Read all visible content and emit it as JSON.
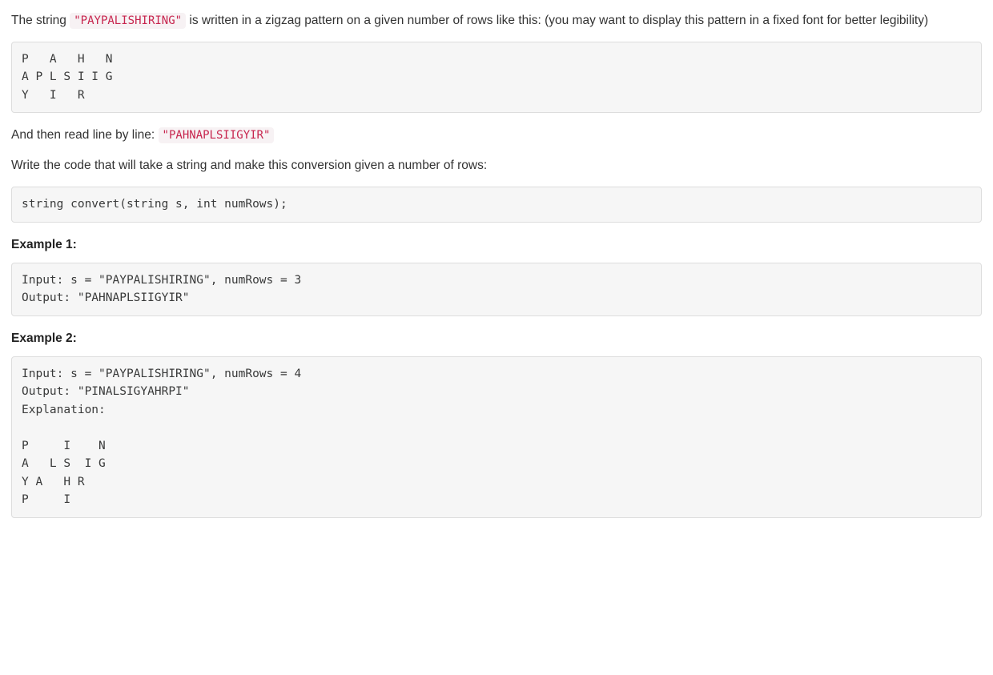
{
  "intro": {
    "before_code": "The string ",
    "code": "\"PAYPALISHIRING\"",
    "after_code": " is written in a zigzag pattern on a given number of rows like this: (you may want to display this pattern in a fixed font for better legibility)"
  },
  "zigzag_block": "P   A   H   N\nA P L S I I G\nY   I   R",
  "read_line": {
    "before_code": "And then read line by line: ",
    "code": "\"PAHNAPLSIIGYIR\""
  },
  "instruction": "Write the code that will take a string and make this conversion given a number of rows:",
  "signature_block": "string convert(string s, int numRows);",
  "example1": {
    "title": "Example 1:",
    "block": "Input: s = \"PAYPALISHIRING\", numRows = 3\nOutput: \"PAHNAPLSIIGYIR\""
  },
  "example2": {
    "title": "Example 2:",
    "block": "Input: s = \"PAYPALISHIRING\", numRows = 4\nOutput: \"PINALSIGYAHRPI\"\nExplanation:\n\nP     I    N\nA   L S  I G\nY A   H R\nP     I"
  }
}
